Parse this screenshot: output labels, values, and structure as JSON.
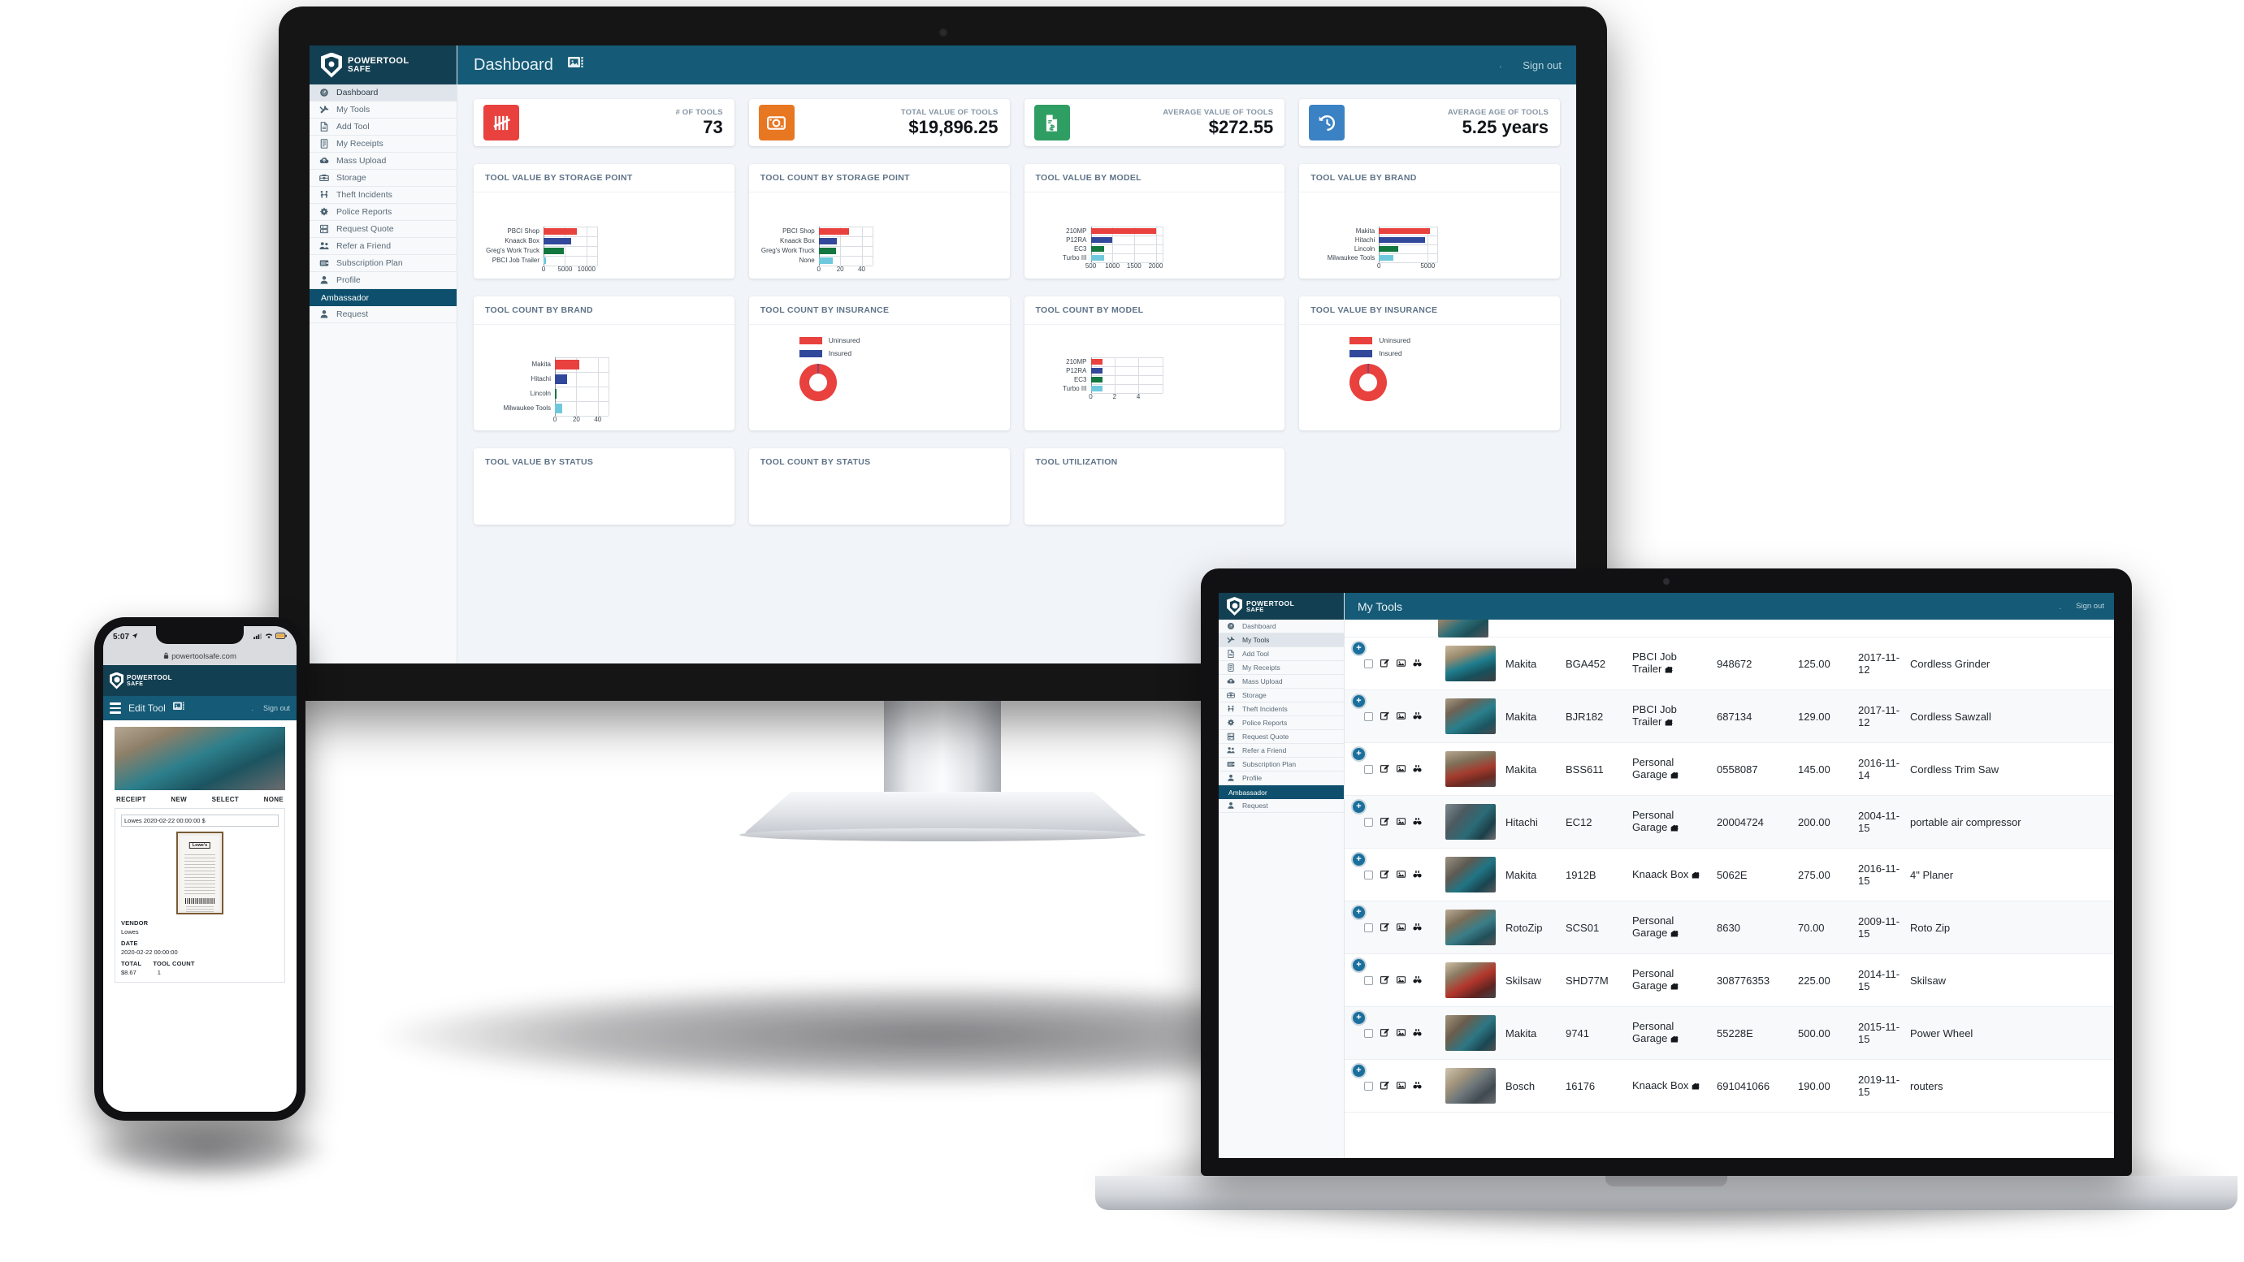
{
  "brand": {
    "word1": "POWERTOOL",
    "word2": "SAFE",
    "tm": "™"
  },
  "desktop": {
    "topbar": {
      "title": "Dashboard",
      "dot": ".",
      "signout": "Sign out",
      "gallery_icon": "images-icon"
    },
    "sidebar": [
      {
        "label": "Dashboard",
        "icon": "gauge-icon",
        "state": "active"
      },
      {
        "label": "My Tools",
        "icon": "tools-icon",
        "state": ""
      },
      {
        "label": "Add Tool",
        "icon": "document-icon",
        "state": ""
      },
      {
        "label": "My Receipts",
        "icon": "receipt-icon",
        "state": ""
      },
      {
        "label": "Mass Upload",
        "icon": "cloud-upload-icon",
        "state": ""
      },
      {
        "label": "Storage",
        "icon": "toolbox-icon",
        "state": ""
      },
      {
        "label": "Theft Incidents",
        "icon": "theft-icon",
        "state": ""
      },
      {
        "label": "Police Reports",
        "icon": "police-badge-icon",
        "state": ""
      },
      {
        "label": "Request Quote",
        "icon": "quote-icon",
        "state": ""
      },
      {
        "label": "Refer a Friend",
        "icon": "people-icon",
        "state": ""
      },
      {
        "label": "Subscription Plan",
        "icon": "wallet-icon",
        "state": ""
      },
      {
        "label": "Profile",
        "icon": "person-icon",
        "state": ""
      },
      {
        "label": "Ambassador",
        "icon": "",
        "state": "section"
      },
      {
        "label": "Request",
        "icon": "person-icon",
        "state": ""
      }
    ],
    "kpis": [
      {
        "label": "# OF TOOLS",
        "value": "73",
        "color": "#e8413e",
        "icon": "tally-marks-icon"
      },
      {
        "label": "TOTAL VALUE OF TOOLS",
        "value": "$19,896.25",
        "color": "#e87722",
        "icon": "banknote-icon"
      },
      {
        "label": "AVERAGE VALUE OF TOOLS",
        "value": "$272.55",
        "color": "#2f9e63",
        "icon": "invoice-icon"
      },
      {
        "label": "AVERAGE AGE OF TOOLS",
        "value": "5.25 years",
        "color": "#3b82c4",
        "icon": "history-clock-icon"
      }
    ],
    "row3_titles": [
      "TOOL VALUE BY STATUS",
      "TOOL COUNT BY STATUS",
      "TOOL UTILIZATION"
    ]
  },
  "chart_data": [
    {
      "type": "bar",
      "orientation": "horizontal",
      "title": "TOOL VALUE BY STORAGE POINT",
      "categories": [
        "PBCI Shop",
        "Knaack Box",
        "Greg's Work Truck",
        "PBCI Job Trailer"
      ],
      "values": [
        7800,
        6500,
        4700,
        600
      ],
      "colors": [
        "#e8413e",
        "#31489b",
        "#14773f",
        "#6fc9dd"
      ],
      "xticks": [
        "0",
        "5000",
        "10000"
      ],
      "xlim": [
        0,
        12500
      ],
      "grid": true,
      "legend": "none",
      "ylabel": "",
      "xlabel": ""
    },
    {
      "type": "bar",
      "orientation": "horizontal",
      "title": "TOOL COUNT BY STORAGE POINT",
      "categories": [
        "PBCI Shop",
        "Knaack Box",
        "Greg's Work Truck",
        "None"
      ],
      "values": [
        28,
        17,
        16,
        13
      ],
      "colors": [
        "#e8413e",
        "#31489b",
        "#14773f",
        "#6fc9dd"
      ],
      "xticks": [
        "0",
        "20",
        "40"
      ],
      "xlim": [
        0,
        50
      ],
      "grid": true,
      "legend": "none",
      "ylabel": "",
      "xlabel": ""
    },
    {
      "type": "bar",
      "orientation": "horizontal",
      "title": "TOOL VALUE BY MODEL",
      "categories": [
        "210MP",
        "P12RA",
        "EC3",
        "Turbo III"
      ],
      "values": [
        2000,
        1000,
        800,
        800
      ],
      "colors": [
        "#e8413e",
        "#31489b",
        "#14773f",
        "#6fc9dd"
      ],
      "xticks": [
        "500",
        "1000",
        "1500",
        "2000"
      ],
      "xlim": [
        500,
        2150
      ],
      "grid": true,
      "legend": "none",
      "ylabel": "",
      "xlabel": ""
    },
    {
      "type": "bar",
      "orientation": "horizontal",
      "title": "TOOL VALUE BY BRAND",
      "categories": [
        "Makita",
        "Hitachi",
        "Lincoln",
        "Milwaukee Tools"
      ],
      "values": [
        5200,
        4700,
        2000,
        1500
      ],
      "colors": [
        "#e8413e",
        "#31489b",
        "#14773f",
        "#6fc9dd"
      ],
      "xticks": [
        "0",
        "5000"
      ],
      "xlim": [
        0,
        6000
      ],
      "grid": true,
      "legend": "none",
      "ylabel": "",
      "xlabel": ""
    },
    {
      "type": "bar",
      "orientation": "horizontal",
      "title": "TOOL COUNT BY BRAND",
      "categories": [
        "Makita",
        "Hitachi",
        "Lincoln",
        "Milwaukee Tools"
      ],
      "values": [
        23,
        11,
        1,
        7
      ],
      "colors": [
        "#e8413e",
        "#31489b",
        "#14773f",
        "#6fc9dd"
      ],
      "xticks": [
        "0",
        "20",
        "40"
      ],
      "xlim": [
        0,
        50
      ],
      "grid": true,
      "legend": "none",
      "ylabel": "",
      "xlabel": ""
    },
    {
      "type": "pie",
      "title": "TOOL COUNT BY INSURANCE",
      "labels": [
        "Uninsured",
        "Insured"
      ],
      "values": [
        99,
        1
      ],
      "colors": [
        "#e8413e",
        "#31489b"
      ],
      "legend": "top",
      "donut": true
    },
    {
      "type": "bar",
      "orientation": "horizontal",
      "title": "TOOL COUNT BY MODEL",
      "categories": [
        "210MP",
        "P12RA",
        "EC3",
        "Turbo III"
      ],
      "values": [
        1,
        1,
        1,
        1
      ],
      "colors": [
        "#e8413e",
        "#31489b",
        "#14773f",
        "#6fc9dd"
      ],
      "xticks": [
        "0",
        "2",
        "4"
      ],
      "xlim": [
        0,
        6
      ],
      "grid": true,
      "legend": "none",
      "ylabel": "",
      "xlabel": ""
    },
    {
      "type": "pie",
      "title": "TOOL VALUE BY INSURANCE",
      "labels": [
        "Uninsured",
        "Insured"
      ],
      "values": [
        99,
        1
      ],
      "colors": [
        "#e8413e",
        "#31489b"
      ],
      "legend": "top",
      "donut": true
    }
  ],
  "laptop": {
    "topbar": {
      "title": "My Tools",
      "dot": ".",
      "signout": "Sign out"
    },
    "sidebar": [
      {
        "label": "Dashboard",
        "icon": "gauge-icon",
        "state": ""
      },
      {
        "label": "My Tools",
        "icon": "tools-icon",
        "state": "active"
      },
      {
        "label": "Add Tool",
        "icon": "document-icon",
        "state": ""
      },
      {
        "label": "My Receipts",
        "icon": "receipt-icon",
        "state": ""
      },
      {
        "label": "Mass Upload",
        "icon": "cloud-upload-icon",
        "state": ""
      },
      {
        "label": "Storage",
        "icon": "toolbox-icon",
        "state": ""
      },
      {
        "label": "Theft Incidents",
        "icon": "theft-icon",
        "state": ""
      },
      {
        "label": "Police Reports",
        "icon": "police-badge-icon",
        "state": ""
      },
      {
        "label": "Request Quote",
        "icon": "quote-icon",
        "state": ""
      },
      {
        "label": "Refer a Friend",
        "icon": "people-icon",
        "state": ""
      },
      {
        "label": "Subscription Plan",
        "icon": "wallet-icon",
        "state": ""
      },
      {
        "label": "Profile",
        "icon": "person-icon",
        "state": ""
      },
      {
        "label": "Ambassador",
        "icon": "",
        "state": "section"
      },
      {
        "label": "Request",
        "icon": "person-icon",
        "state": ""
      }
    ],
    "rows": [
      {
        "brand": "Makita",
        "model": "BGA452",
        "storage": "PBCI Job Trailer",
        "serial": "948672",
        "value": "125.00",
        "date": "2017-11-12",
        "desc": "Cordless Grinder",
        "photo": "ph2"
      },
      {
        "brand": "Makita",
        "model": "BJR182",
        "storage": "PBCI Job Trailer",
        "serial": "687134",
        "value": "129.00",
        "date": "2017-11-12",
        "desc": "Cordless Sawzall",
        "photo": "ph3"
      },
      {
        "brand": "Makita",
        "model": "BSS611",
        "storage": "Personal Garage",
        "serial": "0558087",
        "value": "145.00",
        "date": "2016-11-14",
        "desc": "Cordless Trim Saw",
        "photo": "ph6"
      },
      {
        "brand": "Hitachi",
        "model": "EC12",
        "storage": "Personal Garage",
        "serial": "20004724",
        "value": "200.00",
        "date": "2004-11-15",
        "desc": "portable air compressor",
        "photo": "ph4"
      },
      {
        "brand": "Makita",
        "model": "1912B",
        "storage": "Knaack Box",
        "serial": "5062E",
        "value": "275.00",
        "date": "2016-11-15",
        "desc": "4\" Planer",
        "photo": "ph5"
      },
      {
        "brand": "RotoZip",
        "model": "SCS01",
        "storage": "Personal Garage",
        "serial": "8630",
        "value": "70.00",
        "date": "2009-11-15",
        "desc": "Roto Zip",
        "photo": "ph9"
      },
      {
        "brand": "Skilsaw",
        "model": "SHD77M",
        "storage": "Personal Garage",
        "serial": "308776353",
        "value": "225.00",
        "date": "2014-11-15",
        "desc": "Skilsaw",
        "photo": "ph7"
      },
      {
        "brand": "Makita",
        "model": "9741",
        "storage": "Personal Garage",
        "serial": "55228E",
        "value": "500.00",
        "date": "2015-11-15",
        "desc": "Power Wheel",
        "photo": "ph8"
      },
      {
        "brand": "Bosch",
        "model": "16176",
        "storage": "Knaack Box",
        "serial": "691041066",
        "value": "190.00",
        "date": "2019-11-15",
        "desc": "routers",
        "photo": "ph10"
      }
    ],
    "row_icons": [
      "expand-plus-icon",
      "row-checkbox",
      "edit-icon",
      "image-icon",
      "binoculars-icon",
      "storage-marker-icon"
    ]
  },
  "phone": {
    "status": {
      "time": "5:07",
      "location_icon": "location-arrow-icon",
      "signal_icon": "cellular-icon",
      "wifi_icon": "wifi-icon",
      "battery_icon": "battery-icon"
    },
    "url": {
      "lock_icon": "lock-icon",
      "domain": "powertoolsafe.com"
    },
    "topbar": {
      "menu_icon": "hamburger-icon",
      "title": "Edit Tool",
      "gallery_icon": "images-icon",
      "dot": ".",
      "signout": "Sign out"
    },
    "segments": [
      "RECEIPT",
      "NEW",
      "SELECT",
      "NONE"
    ],
    "receipt_field": "Lowes  2020-02-22 00:00:00 $",
    "receipt_logo": "Lowe's",
    "fields": [
      {
        "label": "VENDOR",
        "value": "Lowes"
      },
      {
        "label": "DATE",
        "value": "2020-02-22 00:00:00"
      }
    ],
    "totals": {
      "label_total": "TOTAL",
      "label_count": "TOOL COUNT",
      "total": "$8.67",
      "count": "1"
    }
  }
}
